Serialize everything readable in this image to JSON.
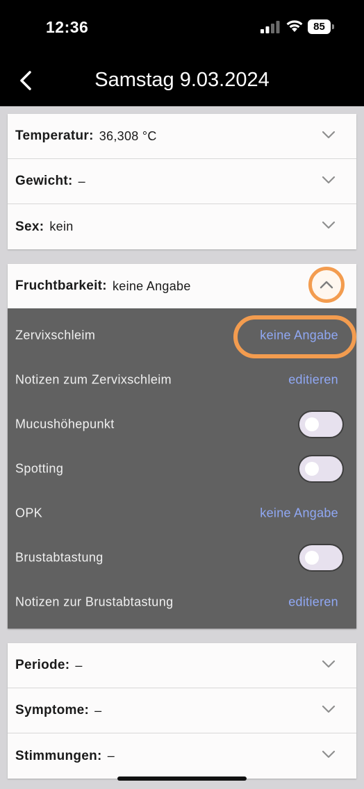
{
  "status_bar": {
    "time": "12:36",
    "battery": "85"
  },
  "header": {
    "title": "Samstag 9.03.2024"
  },
  "group1": [
    {
      "label": "Temperatur:",
      "value": "36,308 °C"
    },
    {
      "label": "Gewicht:",
      "value": "–"
    },
    {
      "label": "Sex:",
      "value": "kein"
    }
  ],
  "fertility": {
    "label": "Fruchtbarkeit:",
    "value": "keine Angabe",
    "rows": [
      {
        "label": "Zervixschleim",
        "value": "keine Angabe"
      },
      {
        "label": "Notizen zum Zervixschleim",
        "value": "editieren"
      },
      {
        "label": "Mucushöhepunkt",
        "toggle": false
      },
      {
        "label": "Spotting",
        "toggle": false
      },
      {
        "label": "OPK",
        "value": "keine Angabe"
      },
      {
        "label": "Brustabtastung",
        "toggle": false
      },
      {
        "label": "Notizen zur Brustabtastung",
        "value": "editieren"
      }
    ]
  },
  "group3": [
    {
      "label": "Periode:",
      "value": "–"
    },
    {
      "label": "Symptome:",
      "value": "–"
    },
    {
      "label": "Stimmungen:",
      "value": "–"
    }
  ],
  "colors": {
    "accent_link": "#90a8f4",
    "highlight": "#f39c4f",
    "panel": "#616161"
  }
}
